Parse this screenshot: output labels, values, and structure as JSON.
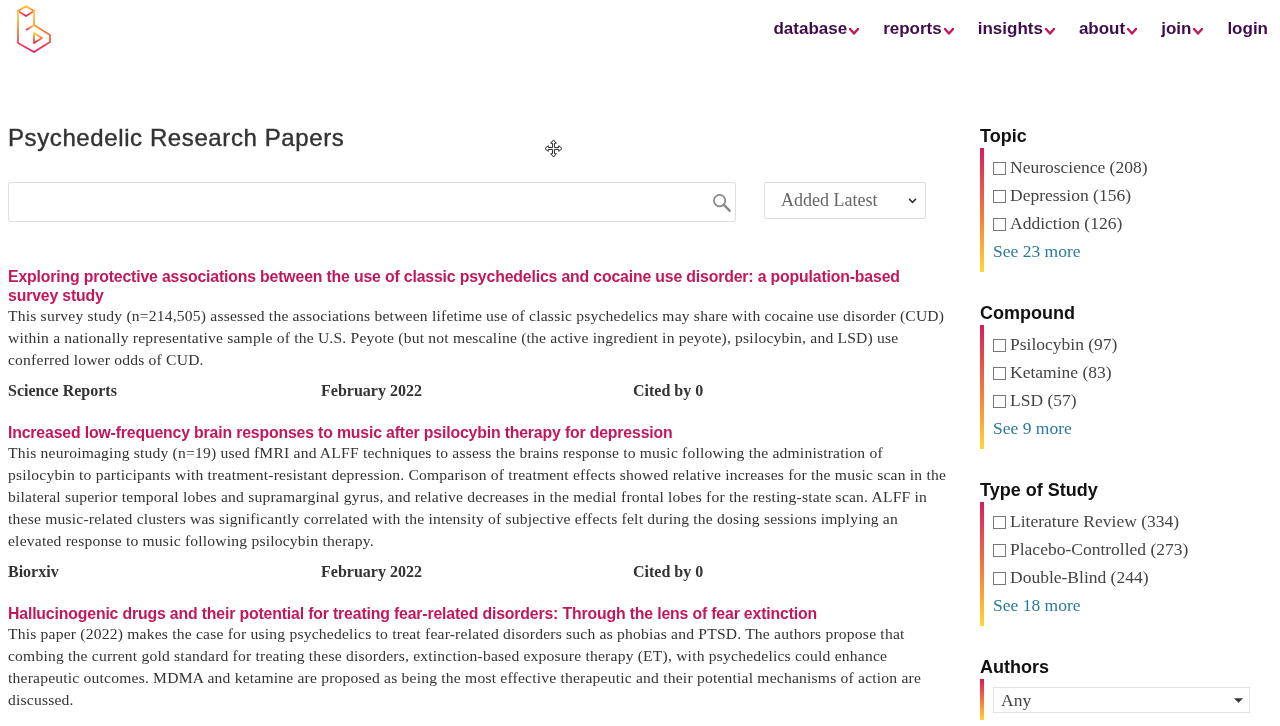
{
  "header": {
    "nav": [
      {
        "label": "database",
        "has_menu": true
      },
      {
        "label": "reports",
        "has_menu": true
      },
      {
        "label": "insights",
        "has_menu": true
      },
      {
        "label": "about",
        "has_menu": true
      },
      {
        "label": "join",
        "has_menu": true
      },
      {
        "label": "login",
        "has_menu": false
      }
    ]
  },
  "title": "Psychedelic Research Papers",
  "sort": {
    "value": "Added Latest"
  },
  "papers": [
    {
      "title": "Exploring protective associations between the use of classic psychedelics and cocaine use disorder: a population-based survey study",
      "summary": "This survey study (n=214,505) assessed the associations between lifetime use of classic psychedelics may share with cocaine use disorder (CUD) within a nationally representative sample of the U.S. Peyote (but not mescaline (the active ingredient in peyote), psilocybin, and LSD) use conferred lower odds of CUD.",
      "journal": "Science Reports",
      "date": "February 2022",
      "citations": "Cited by 0"
    },
    {
      "title": "Increased low-frequency brain responses to music after psilocybin therapy for depression",
      "summary": "This neuroimaging study (n=19) used fMRI and ALFF techniques to assess the brains response to music following the administration of psilocybin to participants with treatment-resistant depression. Comparison of treatment effects showed relative increases for the music scan in the bilateral superior temporal lobes and supramarginal gyrus, and relative decreases in the medial frontal lobes for the resting-state scan. ALFF in these music-related clusters was significantly correlated with the intensity of subjective effects felt during the dosing sessions implying an elevated response to music following psilocybin therapy.",
      "journal": "Biorxiv",
      "date": "February 2022",
      "citations": "Cited by 0"
    },
    {
      "title": "Hallucinogenic drugs and their potential for treating fear-related disorders: Through the lens of fear extinction",
      "summary": "This paper (2022) makes the case for using psychedelics to treat fear-related disorders such as phobias and PTSD. The authors propose that combing the current gold standard for treating these disorders, extinction-based exposure therapy (ET), with psychedelics could enhance therapeutic outcomes. MDMA and ketamine are proposed as being the most effective therapeutic and their potential mechanisms of action are discussed."
    }
  ],
  "filters": [
    {
      "kind": "checklist",
      "title": "Topic",
      "options": [
        {
          "label": "Neuroscience (208)",
          "checked": false
        },
        {
          "label": "Depression (156)",
          "checked": false
        },
        {
          "label": "Addiction (126)",
          "checked": false
        }
      ],
      "more": "See 23 more"
    },
    {
      "kind": "checklist",
      "title": "Compound",
      "options": [
        {
          "label": "Psilocybin (97)",
          "checked": false
        },
        {
          "label": "Ketamine (83)",
          "checked": false
        },
        {
          "label": "LSD (57)",
          "checked": false
        }
      ],
      "more": "See 9 more"
    },
    {
      "kind": "checklist",
      "title": "Type of Study",
      "options": [
        {
          "label": "Literature Review (334)",
          "checked": false
        },
        {
          "label": "Placebo-Controlled (273)",
          "checked": false
        },
        {
          "label": "Double-Blind (244)",
          "checked": false
        }
      ],
      "more": "See 18 more"
    },
    {
      "kind": "select",
      "title": "Authors",
      "value": "Any"
    }
  ]
}
